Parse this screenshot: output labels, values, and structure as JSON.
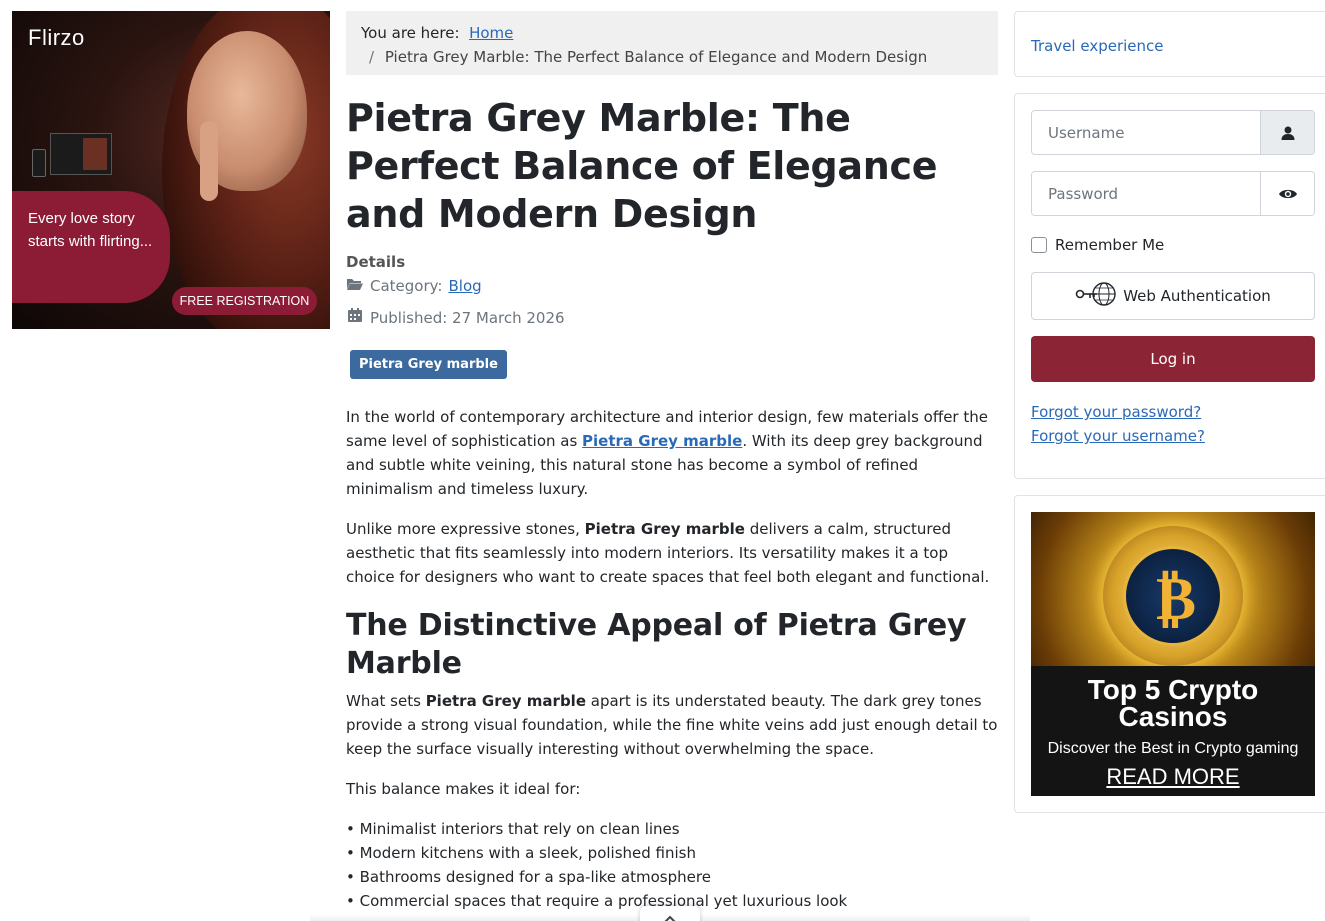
{
  "ad_left": {
    "brand": "Flirzo",
    "tagline": "Every love story starts with flirting...",
    "cta": "FREE REGISTRATION"
  },
  "breadcrumb": {
    "prefix": "You are here:",
    "home": "Home",
    "separator": "/",
    "current": "Pietra Grey Marble: The Perfect Balance of Elegance and Modern Design"
  },
  "article": {
    "title": "Pietra Grey Marble: The Perfect Balance of Elegance and Modern Design",
    "details_label": "Details",
    "category_label": "Category:",
    "category": "Blog",
    "published": "Published: 27 March 2026",
    "tag": "Pietra Grey marble",
    "p1_before": "In the world of contemporary architecture and interior design, few materials offer the same level of sophistication as ",
    "p1_link": "Pietra Grey marble",
    "p1_after": ". With its deep grey background and subtle white veining, this natural stone has become a symbol of refined minimalism and timeless luxury.",
    "p2_before": "Unlike more expressive stones, ",
    "p2_bold": "Pietra Grey marble",
    "p2_after": " delivers a calm, structured aesthetic that fits seamlessly into modern interiors. Its versatility makes it a top choice for designers who want to create spaces that feel both elegant and functional.",
    "h2": "The Distinctive Appeal of Pietra Grey Marble",
    "p3_before": "What sets ",
    "p3_bold": "Pietra Grey marble",
    "p3_after": " apart is its understated beauty. The dark grey tones provide a strong visual foundation, while the fine white veins add just enough detail to keep the surface visually interesting without overwhelming the space.",
    "p4": "This balance makes it ideal for:",
    "bullets": [
      "• Minimalist interiors that rely on clean lines",
      "• Modern kitchens with a sleek, polished finish",
      "• Bathrooms designed for a spa-like atmosphere",
      "• Commercial spaces that require a professional yet luxurious look"
    ]
  },
  "sidebar": {
    "travel_link": "Travel experience",
    "login": {
      "username_placeholder": "Username",
      "password_placeholder": "Password",
      "remember": "Remember Me",
      "webauth": "Web Authentication",
      "submit": "Log in",
      "forgot_password": "Forgot your password?",
      "forgot_username": "Forgot your username?"
    },
    "ad": {
      "coin_symbol": "₿",
      "title": "Top 5 Crypto Casinos",
      "subtitle": "Discover the Best in Crypto gaming",
      "cta": "READ MORE"
    }
  },
  "colors": {
    "link": "#2a69b8",
    "login_button": "#8b2535",
    "tag_badge": "#3c6a9e",
    "ad_accent": "#8c1b36"
  }
}
